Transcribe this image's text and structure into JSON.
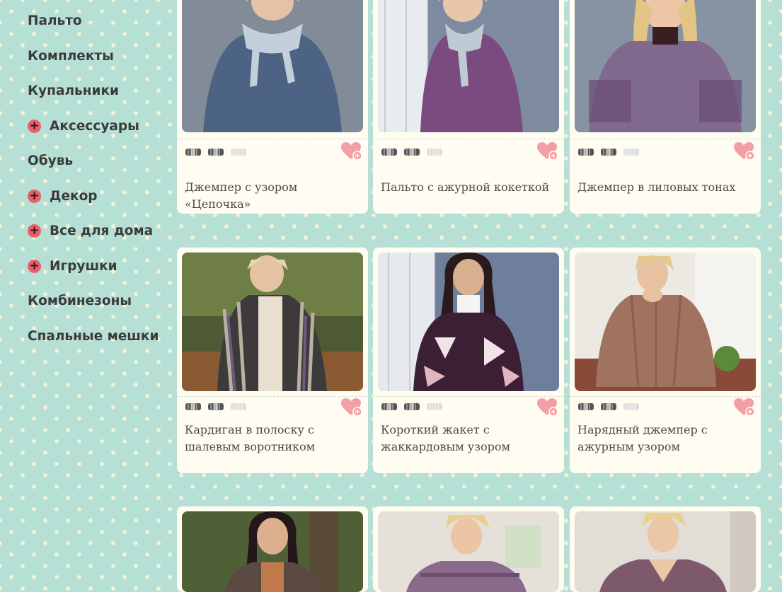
{
  "sidebar": {
    "categories": [
      {
        "label": "Пальто",
        "expandable": false
      },
      {
        "label": "Комплекты",
        "expandable": false
      },
      {
        "label": "Купальники",
        "expandable": false
      },
      {
        "label": "Аксессуары",
        "expandable": true
      },
      {
        "label": "Обувь",
        "expandable": false
      },
      {
        "label": "Декор",
        "expandable": true
      },
      {
        "label": "Все для дома",
        "expandable": true
      },
      {
        "label": "Игрушки",
        "expandable": true
      },
      {
        "label": "Комбинезоны",
        "expandable": false
      },
      {
        "label": "Спальные мешки",
        "expandable": false
      }
    ]
  },
  "products": [
    {
      "title": "Джемпер с узором «Цепочка»",
      "difficulty": 2,
      "difficulty_max": 3,
      "image": "woman-grey-blue-sweater-scarf"
    },
    {
      "title": "Пальто с ажурной кокеткой",
      "difficulty": 2,
      "difficulty_max": 3,
      "image": "woman-purple-coat-scarf"
    },
    {
      "title": "Джемпер в лиловых тонах",
      "difficulty": 2,
      "difficulty_max": 3,
      "image": "woman-lilac-jumper"
    },
    {
      "title": "Кардиган в полоску с шалевым воротником",
      "difficulty": 2,
      "difficulty_max": 3,
      "image": "woman-striped-cardigan-forest"
    },
    {
      "title": "Короткий жакет с жаккардовым узором",
      "difficulty": 2,
      "difficulty_max": 3,
      "image": "woman-dark-jacquard-jacket"
    },
    {
      "title": "Нарядный джемпер с ажурным узором",
      "difficulty": 2,
      "difficulty_max": 3,
      "image": "woman-brown-lace-jumper"
    },
    {
      "image": "woman-dark-hair-forest"
    },
    {
      "image": "woman-purple-cardigan"
    },
    {
      "image": "woman-mauve-jumper"
    }
  ],
  "colors": {
    "background": "#b6dfd6",
    "dots": "#f4f2d6",
    "card": "#fffdf1",
    "accent": "#e8606a",
    "heart": "#f2a0a8"
  },
  "icons": {
    "expand": "plus-circle-icon",
    "favorite": "heart-plus-icon",
    "difficulty": "yarn-skein-icon"
  }
}
